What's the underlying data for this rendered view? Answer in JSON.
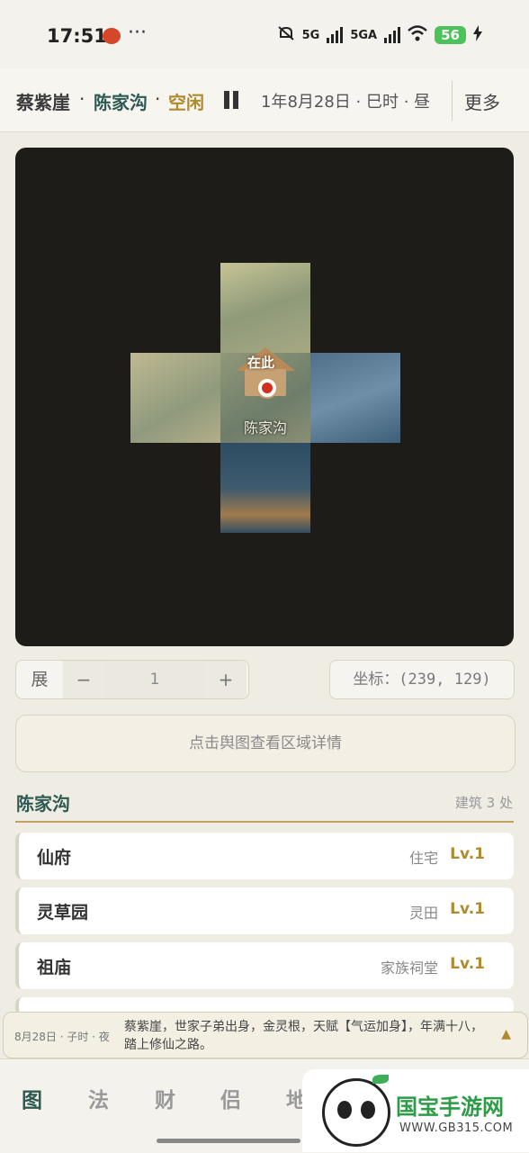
{
  "statusbar": {
    "time": "17:51",
    "more": "···",
    "net1": "5G",
    "net2": "5GA",
    "battery": "56"
  },
  "header": {
    "character": "蔡紫崖",
    "separator": "·",
    "location": "陈家沟",
    "status": "空闲",
    "date": "1年8月28日 · 巳时 · 昼",
    "more": "更多"
  },
  "map": {
    "marker_label": "在此",
    "place_label": "陈家沟"
  },
  "controls": {
    "zoom_label": "展",
    "zoom_minus": "−",
    "zoom_value": "1",
    "zoom_plus": "+",
    "coord_text": "坐标：(239, 129)",
    "detail_button": "点击舆图查看区域详情"
  },
  "region": {
    "title": "陈家沟",
    "count_text": "建筑 3 处",
    "buildings": [
      {
        "name": "仙府",
        "type": "住宅",
        "level": "Lv.1"
      },
      {
        "name": "灵草园",
        "type": "灵田",
        "level": "Lv.1"
      },
      {
        "name": "祖庙",
        "type": "家族祠堂",
        "level": "Lv.1"
      }
    ]
  },
  "notice": {
    "time": "8月28日 · 子时 · 夜",
    "text": "蔡紫崖，世家子弟出身，金灵根，天赋【气运加身】，年满十八，踏上修仙之路。",
    "arrow": "▲"
  },
  "nav": {
    "items": [
      "图",
      "法",
      "财",
      "侣",
      "地"
    ]
  },
  "watermark": {
    "title": "国宝手游网",
    "sub": "WWW.GB315.COM"
  }
}
